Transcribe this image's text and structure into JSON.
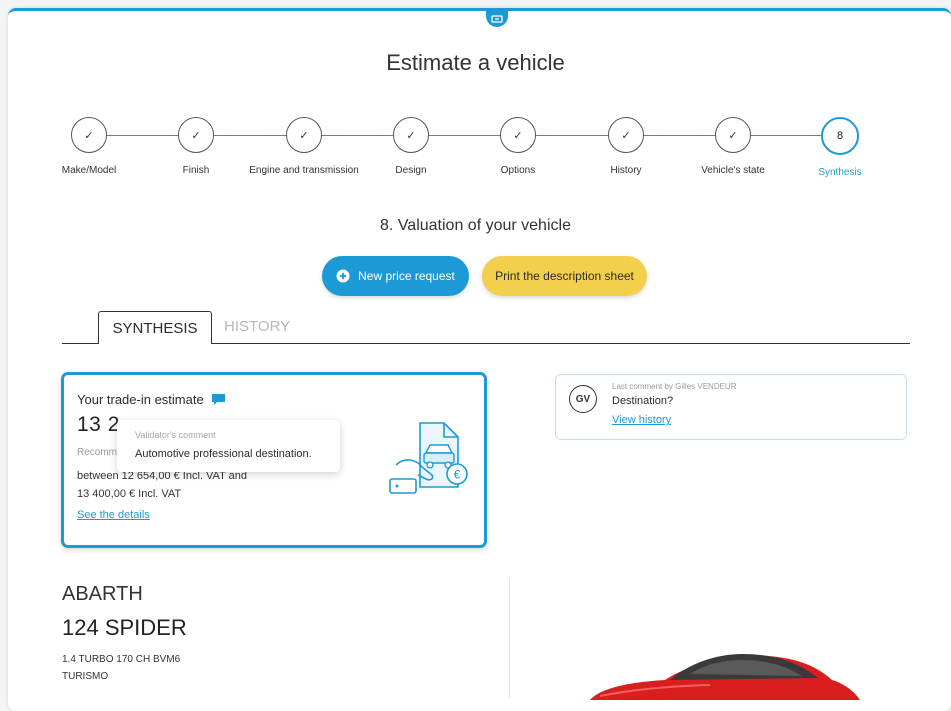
{
  "header": {
    "title": "Estimate a vehicle"
  },
  "stepper": {
    "steps": [
      {
        "label": "Make/Model",
        "mark": "✓"
      },
      {
        "label": "Finish",
        "mark": "✓"
      },
      {
        "label": "Engine and transmission",
        "mark": "✓"
      },
      {
        "label": "Design",
        "mark": "✓"
      },
      {
        "label": "Options",
        "mark": "✓"
      },
      {
        "label": "History",
        "mark": "✓"
      },
      {
        "label": "Vehicle's state",
        "mark": "✓"
      },
      {
        "label": "Synthesis",
        "mark": "8"
      }
    ],
    "active_index": 7
  },
  "section": {
    "title": "8. Valuation of your vehicle"
  },
  "actions": {
    "new_price_request": "New price request",
    "print_sheet": "Print the description sheet"
  },
  "tabs": {
    "synthesis": "SYNTHESIS",
    "history": "HISTORY"
  },
  "estimate": {
    "title": "Your trade-in estimate",
    "price": "13 2",
    "recommended_prefix": "Recomm",
    "range_line1": "between 12 654,00 € Incl. VAT and",
    "range_line2": "13 400,00 € Incl. VAT",
    "details_link": "See the details"
  },
  "tooltip": {
    "caption": "Validator's comment",
    "text": "Automotive professional destination."
  },
  "comment": {
    "initials": "GV",
    "caption": "Last comment by Gilles VENDEUR",
    "text": "Destination?",
    "link": "View history"
  },
  "vehicle": {
    "brand": "ABARTH",
    "model": "124 SPIDER",
    "version": "1.4 TURBO 170 CH BVM6",
    "body": "TURISMO"
  },
  "colors": {
    "accent": "#1c9ad6",
    "yellow": "#f3d04c",
    "car_red": "#d91e1e"
  },
  "icons": [
    "chat-bubble-icon",
    "plus-circle-icon",
    "check-icon",
    "car-document-icon",
    "euro-coin-icon"
  ]
}
